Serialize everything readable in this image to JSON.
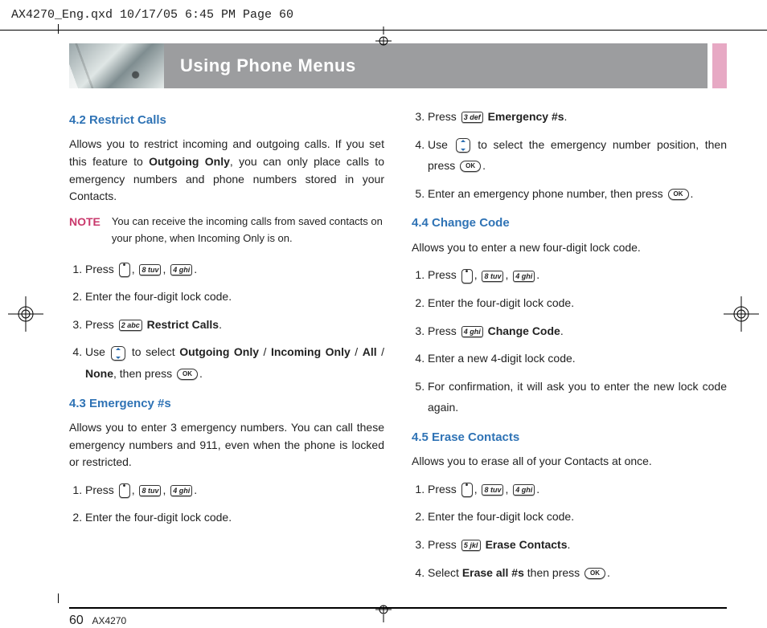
{
  "slug": "AX4270_Eng.qxd  10/17/05  6:45 PM  Page 60",
  "header": {
    "title": "Using Phone Menus"
  },
  "keys": {
    "k2": "2 abc",
    "k3": "3 def",
    "k4": "4 ghi",
    "k5": "5 jkl",
    "k8": "8 tuv",
    "ok": "OK"
  },
  "left": {
    "s42": {
      "title": "4.2 Restrict Calls",
      "intro_a": "Allows you to restrict incoming and outgoing calls. If you set this feature to ",
      "intro_bold": "Outgoing Only",
      "intro_b": ", you can only place calls to emergency numbers and phone numbers stored in your Contacts.",
      "note_label": "NOTE",
      "note_text": "You can receive the incoming calls from saved contacts on your phone, when Incoming Only is on.",
      "li1_a": "Press ",
      "li2": "Enter the four-digit lock code.",
      "li3_a": "Press ",
      "li3_bold": "Restrict Calls",
      "li4_a": "Use ",
      "li4_b": " to select ",
      "li4_opt1": "Outgoing Only",
      "li4_opt2": "Incoming Only",
      "li4_opt3": "All",
      "li4_opt4": "None",
      "li4_c": ", then press "
    },
    "s43": {
      "title": "4.3 Emergency #s",
      "intro": "Allows you to enter 3 emergency numbers. You can call these emergency numbers and 911, even when the phone is locked or restricted.",
      "li1_a": "Press ",
      "li2": "Enter the four-digit lock code."
    }
  },
  "right": {
    "s43c": {
      "li3_a": "Press ",
      "li3_bold": "Emergency #s",
      "li4_a": "Use ",
      "li4_b": " to select the emergency number position, then press ",
      "li5_a": "Enter an emergency phone number, then press "
    },
    "s44": {
      "title": "4.4 Change Code",
      "intro": "Allows you to enter a new four-digit lock code.",
      "li1_a": "Press ",
      "li2": "Enter the four-digit lock code.",
      "li3_a": "Press ",
      "li3_bold": "Change Code",
      "li4": "Enter a new 4-digit lock code.",
      "li5": "For confirmation, it will ask you to enter the new lock code again."
    },
    "s45": {
      "title": "4.5 Erase Contacts",
      "intro": "Allows you to erase all of your Contacts at once.",
      "li1_a": "Press ",
      "li2": "Enter the four-digit lock code.",
      "li3_a": "Press ",
      "li3_bold": "Erase Contacts",
      "li4_a": "Select ",
      "li4_bold": "Erase all #s",
      "li4_b": " then press "
    }
  },
  "footer": {
    "page": "60",
    "model": "AX4270"
  }
}
